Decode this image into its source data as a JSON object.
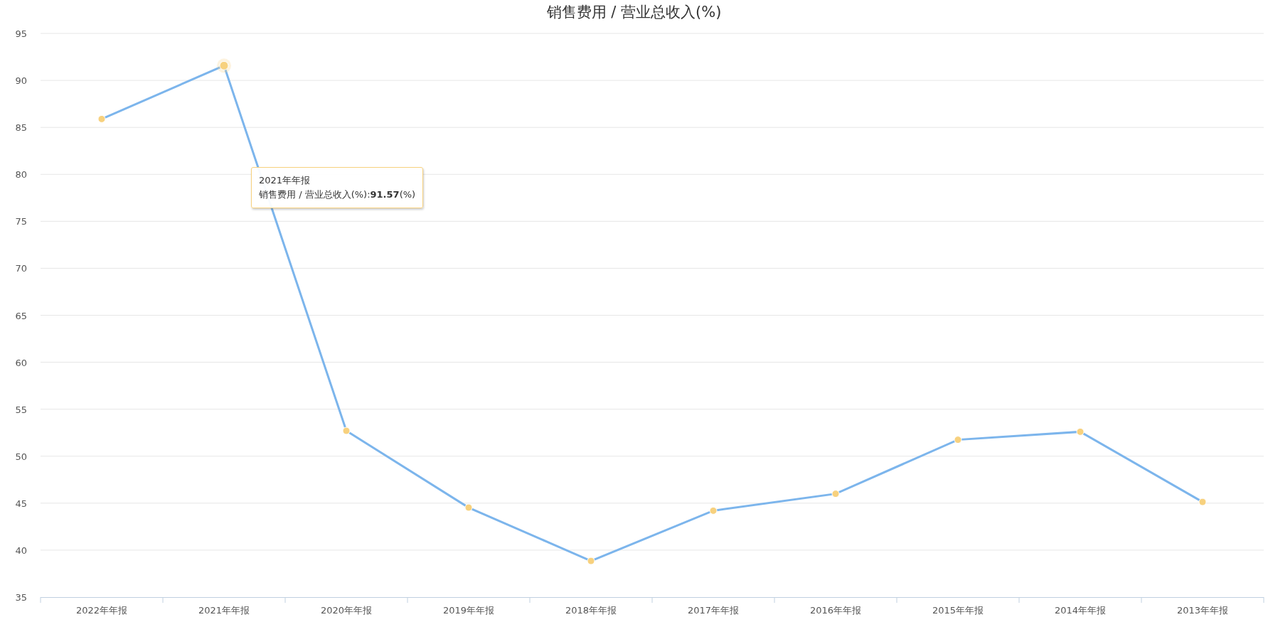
{
  "chart_data": {
    "type": "line",
    "title": "销售费用 / 营业总收入(%)",
    "categories": [
      "2022年年报",
      "2021年年报",
      "2020年年报",
      "2019年年报",
      "2018年年报",
      "2017年年报",
      "2016年年报",
      "2015年年报",
      "2014年年报",
      "2013年年报"
    ],
    "grid": true,
    "series": [
      {
        "color": "#7cb5ec",
        "marker": true,
        "values": [
          85.89,
          91.57,
          52.7,
          44.53,
          38.85,
          44.2,
          46.0,
          51.75,
          52.6,
          45.13
        ]
      }
    ],
    "ylim": [
      35,
      95
    ],
    "yticks": [
      35,
      40,
      45,
      50,
      55,
      60,
      65,
      70,
      75,
      80,
      85,
      90,
      95
    ]
  },
  "tooltip": {
    "title": "2021年年报",
    "text": "销售费用 / 营业总收入(%):**91.57**(%)"
  }
}
